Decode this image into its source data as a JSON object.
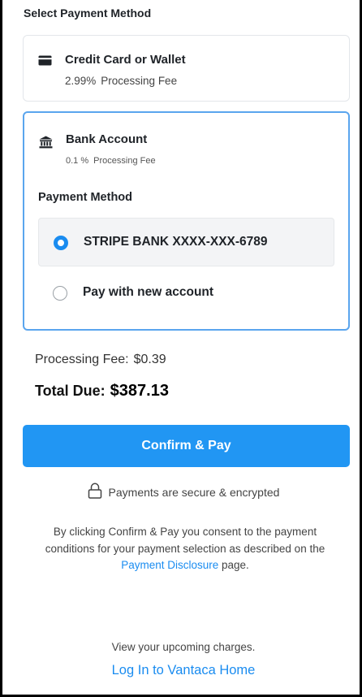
{
  "header": {
    "title": "Select Payment Method"
  },
  "options": [
    {
      "icon": "credit-card-icon",
      "title": "Credit Card or Wallet",
      "fee_percent": "2.99%",
      "fee_label": "Processing Fee"
    },
    {
      "icon": "bank-icon",
      "title": "Bank Account",
      "fee_percent": "0.1 %",
      "fee_label": "Processing Fee",
      "selected": true,
      "payment_method_label": "Payment Method",
      "methods": [
        {
          "label": "STRIPE BANK XXXX-XXX-6789",
          "selected": true
        },
        {
          "label": "Pay with new account",
          "selected": false
        }
      ]
    }
  ],
  "summary": {
    "fee_label": "Processing Fee:",
    "fee_value": "$0.39",
    "total_label": "Total Due:",
    "total_value": "$387.13"
  },
  "confirm_button": "Confirm & Pay",
  "secure_note": {
    "icon": "lock-icon",
    "text": "Payments are secure & encrypted"
  },
  "consent": {
    "text_before": "By clicking Confirm & Pay you consent to the payment conditions for your payment selection as described on the",
    "link": "Payment Disclosure",
    "text_after": "page."
  },
  "footer": {
    "upcoming": "View your upcoming charges.",
    "login_link": "Log In to Vantaca Home"
  },
  "colors": {
    "accent": "#2196f3",
    "selected_border": "#5aa5ee",
    "link": "#1a8cf0"
  }
}
